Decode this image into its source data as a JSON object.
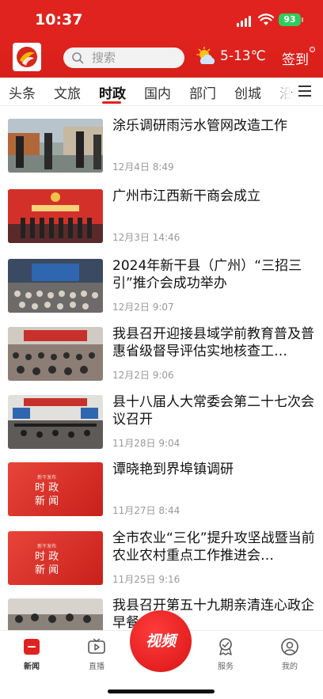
{
  "status": {
    "time": "10:37",
    "battery": "93"
  },
  "header": {
    "search_placeholder": "搜索",
    "weather": "5-13℃",
    "signin": "签到",
    "weather_icon": "sun-cloud-icon"
  },
  "tabs": [
    "头条",
    "文旅",
    "时政",
    "国内",
    "部门",
    "创城",
    "沿"
  ],
  "active_tab": "时政",
  "news": [
    {
      "title": "涂乐调研雨污水管网改造工作",
      "date": "12月4日 8:49"
    },
    {
      "title": "广州市江西新干商会成立",
      "date": "12月3日 14:46"
    },
    {
      "title": "2024年新干县（广州）“三招三引”推介会成功举办",
      "date": "12月2日 9:07"
    },
    {
      "title": "我县召开迎接县域学前教育普及普惠省级督导评估实地核查工…",
      "date": "12月2日 9:06"
    },
    {
      "title": "县十八届人大常委会第二十七次会议召开",
      "date": "11月28日 9:04"
    },
    {
      "title": "谭晓艳到界埠镇调研",
      "date": "11月27日 8:44"
    },
    {
      "title": "全市农业“三化”提升攻坚战暨当前农业农村重点工作推进会…",
      "date": "11月25日 9:16"
    },
    {
      "title": "我县召开第五十九期亲清连心政企早餐会",
      "date": ""
    }
  ],
  "thumb_stamp": {
    "small": "新干发布",
    "line1": "时 政",
    "line2": "新 闻"
  },
  "bottom_nav": {
    "news": "新闻",
    "live": "直播",
    "video": "视频",
    "service": "服务",
    "mine": "我的"
  },
  "colors": {
    "brand": "#e0231e",
    "battery": "#2fcc5f"
  }
}
